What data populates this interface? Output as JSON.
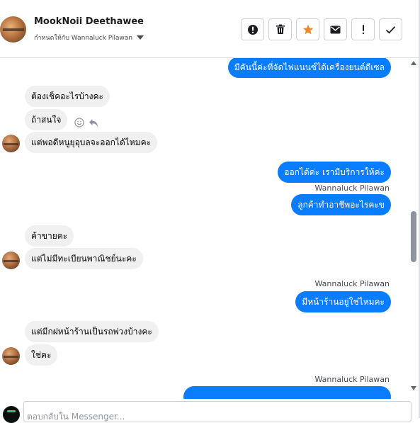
{
  "header": {
    "name": "MookNoii Deethawee",
    "assigned_to": "กำหนดให้กับ Wannaluck Pilawan",
    "actions": [
      {
        "name": "mark-important-button",
        "icon": "alert-circle-icon"
      },
      {
        "name": "delete-button",
        "icon": "trash-icon"
      },
      {
        "name": "star-button",
        "icon": "star-icon",
        "color": "#e88a2d"
      },
      {
        "name": "mark-unread-button",
        "icon": "envelope-icon"
      },
      {
        "name": "spam-button",
        "icon": "exclamation-icon"
      },
      {
        "name": "mark-done-button",
        "icon": "check-icon"
      }
    ]
  },
  "conversation": {
    "messages": [
      {
        "text": "มีคันนี้ค่ะที่จัดไฟแนนซ์ได้เครื่องยนต์ดีเซล",
        "direction": "outgoing"
      },
      {
        "text": "ต้องเช็คอะไรบ้างคะ",
        "direction": "incoming"
      },
      {
        "text": "ถ้าสนใจ",
        "direction": "incoming"
      },
      {
        "text": "แต่พอดีหนูยุอุบลจะออกได้ไหมคะ",
        "direction": "incoming"
      },
      {
        "text": "ออกได้ค่ะ เรามีบริการให้ค่ะ",
        "direction": "outgoing"
      },
      {
        "sender": "Wannaluck Pilawan"
      },
      {
        "text": "ลูกค้าทำอาชีพอะไรคะข",
        "direction": "outgoing"
      },
      {
        "text": "ค้าขายคะ",
        "direction": "incoming"
      },
      {
        "text": "แต่ไม่มีทะเบียนพาณิชย์นะคะ",
        "direction": "incoming"
      },
      {
        "sender": "Wannaluck Pilawan"
      },
      {
        "text": "มีหน้าร้านอยู่ใช่ไหมคะ",
        "direction": "outgoing"
      },
      {
        "text": "แต่มีกฝหน้าร้านเป็นรถพ่วงบ้างคะ",
        "direction": "incoming"
      },
      {
        "text": "ใช่คะ",
        "direction": "incoming"
      },
      {
        "sender": "Wannaluck Pilawan"
      }
    ]
  },
  "composer": {
    "placeholder": "ตอบกลับใน Messenger..."
  },
  "colors": {
    "outgoing_bubble": "#0a7cff",
    "incoming_bubble": "#f0f0f0",
    "star": "#e88a2d"
  }
}
